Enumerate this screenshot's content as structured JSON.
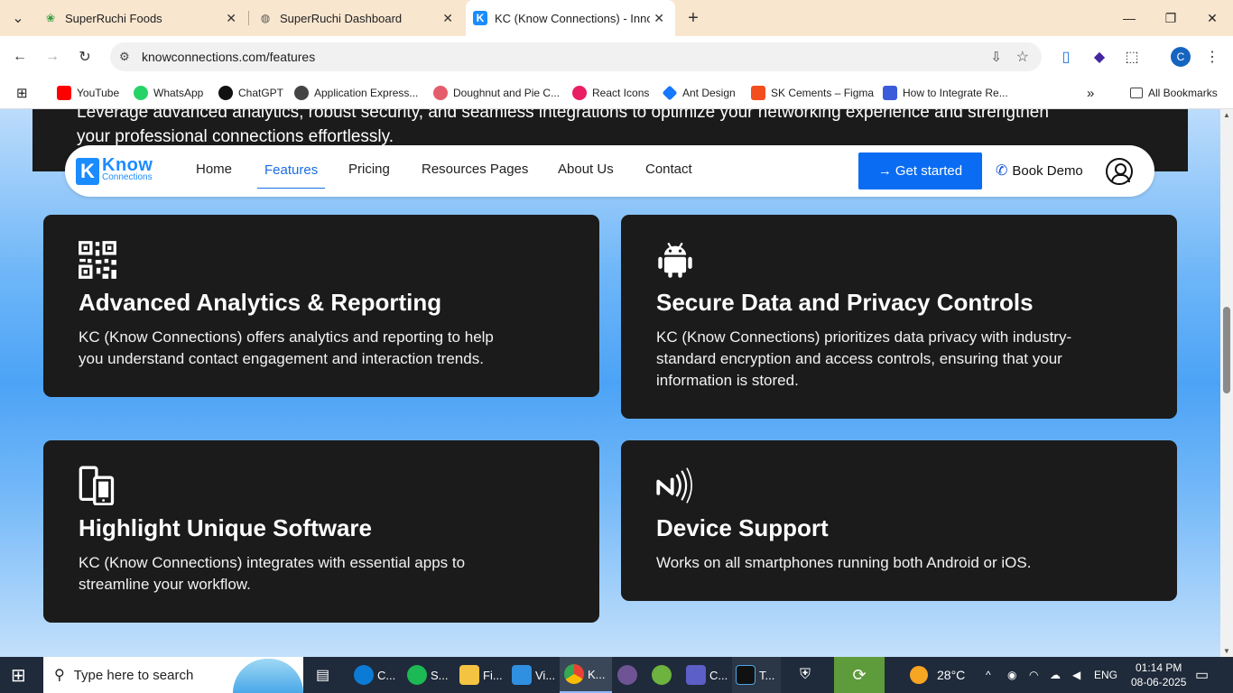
{
  "browser": {
    "tabs": [
      {
        "title": "SuperRuchi Foods"
      },
      {
        "title": "SuperRuchi Dashboard"
      },
      {
        "title": "KC (Know Connections) - Innov"
      }
    ],
    "url": "knowconnections.com/features",
    "bookmarks": [
      {
        "label": "YouTube",
        "color": "#ff0000"
      },
      {
        "label": "WhatsApp",
        "color": "#25d366"
      },
      {
        "label": "ChatGPT",
        "color": "#111111"
      },
      {
        "label": "Application Express...",
        "color": "#444444"
      },
      {
        "label": "Doughnut and Pie C...",
        "color": "#e35d6a"
      },
      {
        "label": "React Icons",
        "color": "#e91e63"
      },
      {
        "label": "Ant Design",
        "color": "#1677ff"
      },
      {
        "label": "SK Cements – Figma",
        "color": "#f24e1e"
      },
      {
        "label": "How to Integrate Re...",
        "color": "#3b5bdb"
      }
    ],
    "all_bookmarks": "All Bookmarks",
    "profile_initial": "C"
  },
  "hero": {
    "text_line1": "Leverage advanced analytics, robust security, and seamless integrations to optimize your networking experience and strengthen",
    "text_line2": "your professional connections effortlessly."
  },
  "navbar": {
    "logo_word1": "Know",
    "logo_word2": "Connections",
    "links": [
      "Home",
      "Features",
      "Pricing",
      "Resources Pages",
      "About Us",
      "Contact"
    ],
    "active_link": "Features",
    "cta": "Get started",
    "book_demo": "Book Demo"
  },
  "features": [
    {
      "icon": "qr-code-icon",
      "title": "Advanced Analytics & Reporting",
      "desc_line1": "KC (Know Connections) offers analytics and reporting to help",
      "desc_line2": "you understand contact engagement and interaction trends.",
      "desc_line3": ""
    },
    {
      "icon": "android-icon",
      "title": "Secure Data and Privacy Controls",
      "desc_line1": "KC (Know Connections) prioritizes data privacy with industry-",
      "desc_line2": "standard encryption and access controls, ensuring that your",
      "desc_line3": "information is stored."
    },
    {
      "icon": "devices-icon",
      "title": "Highlight Unique Software",
      "desc_line1": "KC (Know Connections) integrates with essential apps to",
      "desc_line2": "streamline your workflow.",
      "desc_line3": ""
    },
    {
      "icon": "nfc-icon",
      "title": "Device Support",
      "desc_line1": "Works on all smartphones running both Android or iOS.",
      "desc_line2": "",
      "desc_line3": ""
    }
  ],
  "taskbar": {
    "search_placeholder": "Type here to search",
    "apps": [
      {
        "label": "C...",
        "color": "#0c7bd6"
      },
      {
        "label": "S...",
        "color": "#1db954"
      },
      {
        "label": "Fi...",
        "color": "#f5c342"
      },
      {
        "label": "Vi...",
        "color": "#2f8fe0"
      },
      {
        "label": "K...",
        "color": "#e8453c"
      },
      {
        "label": "",
        "color": "#6e5494"
      },
      {
        "label": "",
        "color": "#6db33f"
      },
      {
        "label": "C...",
        "color": "#5b5fc7"
      },
      {
        "label": "T...",
        "color": "#1c1c1c"
      }
    ],
    "weather": "28°C",
    "language": "ENG",
    "time": "01:14 PM",
    "date": "08-06-2025"
  },
  "colors": {
    "accent": "#0a6cf2",
    "card_bg": "#1b1b1b",
    "tab_bar": "#f9e6cf"
  }
}
